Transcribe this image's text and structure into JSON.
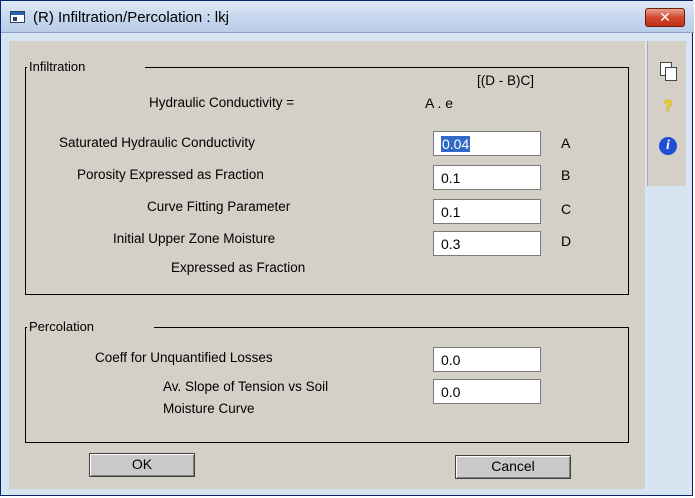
{
  "window": {
    "title": "(R) Infiltration/Percolation : lkj",
    "close_label": "✕"
  },
  "toolbar": {
    "copy_icon": "copy-icon",
    "help_icon": "help-icon",
    "help_glyph": "?",
    "info_icon": "info-icon",
    "info_glyph": "i"
  },
  "infiltration": {
    "title": "Infiltration",
    "formula_exponent": "[(D - B)C]",
    "formula_lhs": "Hydraulic Conductivity =",
    "formula_rhs": "A . e",
    "fields": [
      {
        "label": "Saturated Hydraulic Conductivity",
        "value": "0.04",
        "letter": "A"
      },
      {
        "label": "Porosity Expressed as Fraction",
        "value": "0.1",
        "letter": "B"
      },
      {
        "label": "Curve Fitting Parameter",
        "value": "0.1",
        "letter": "C"
      },
      {
        "label": "Initial Upper Zone Moisture",
        "label2": "Expressed as Fraction",
        "value": "0.3",
        "letter": "D"
      }
    ]
  },
  "percolation": {
    "title": "Percolation",
    "fields": [
      {
        "label": "Coeff for Unquantified Losses",
        "value": "0.0"
      },
      {
        "label": "Av. Slope of Tension vs Soil",
        "label2": "Moisture Curve",
        "value": "0.0"
      }
    ]
  },
  "buttons": {
    "ok": "OK",
    "cancel": "Cancel"
  }
}
